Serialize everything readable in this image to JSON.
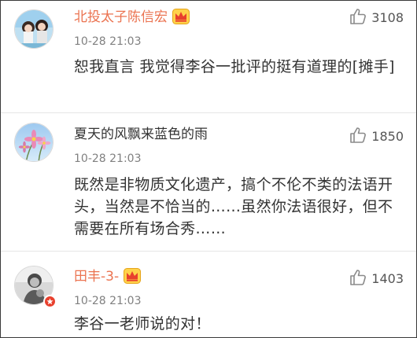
{
  "comments": [
    {
      "username": "北投太子陈信宏",
      "time": "10-28 21:03",
      "text": "恕我直言 我觉得李谷一批评的挺有道理的[摊手]",
      "likes": "3108",
      "username_color": "#eb7350",
      "icon": "crown-icon"
    },
    {
      "username": "夏天的风飘来蓝色的雨",
      "time": "10-28 21:03",
      "text": "既然是非物质文化遗产，搞个不伦不类的法语开头，当然是不恰当的……虽然你法语很好，但不需要在所有场合秀……",
      "likes": "1850",
      "username_color": "#333333"
    },
    {
      "username": "田丰-3-",
      "time": "10-28 21:03",
      "text": "李谷一老师说的对！",
      "likes": "1403",
      "username_color": "#eb7350",
      "icon": "crown-icon"
    }
  ]
}
